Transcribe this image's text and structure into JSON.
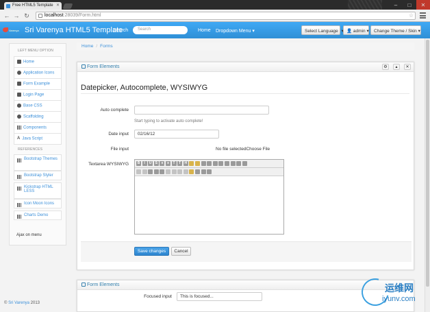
{
  "browser": {
    "tab_title": "Free HTML5 Template",
    "url_host": "localhost",
    "url_path": ":28039/Form.html"
  },
  "nav": {
    "logo_text": "Varenya",
    "brand": "Sri Varenya HTML5 Template",
    "search_label": "Search",
    "search_placeholder": "Search",
    "home": "Home",
    "dropdown": "Dropdown Menu",
    "language": "Select Language",
    "admin": "admin",
    "theme": "Change Theme / Skin"
  },
  "sidebar": {
    "main_heading": "LEFT MENU OPTION",
    "items": [
      {
        "label": "Home",
        "icon": "home-icon"
      },
      {
        "label": "Application Icons",
        "icon": "globe-icon"
      },
      {
        "label": "Form Example",
        "icon": "edit-icon"
      },
      {
        "label": "Login Page",
        "icon": "lock-icon"
      },
      {
        "label": "Base CSS",
        "icon": "eye-icon"
      },
      {
        "label": "Scaffolding",
        "icon": "globe-icon"
      },
      {
        "label": "Components",
        "icon": "grid-icon"
      },
      {
        "label": "Java Script",
        "icon": "font-icon"
      }
    ],
    "ref_heading": "REFERENCES",
    "refs": [
      {
        "label": "Bootstrap Themes"
      },
      {
        "label": "Bootstrap Styler"
      },
      {
        "label": "Kickstrap HTML LESS"
      },
      {
        "label": "Icon Moon Icons"
      },
      {
        "label": "Charts Demo"
      }
    ],
    "ajax": "Ajax on menu"
  },
  "footer": {
    "copy": "©",
    "link": "Sri Varenya",
    "year": "2013"
  },
  "breadcrumb": {
    "home": "Home",
    "sep": "/",
    "current": "Forms"
  },
  "box1": {
    "title": "Form Elements",
    "form_title": "Datepicker, Autocomplete, WYSIWYG",
    "autocomplete_label": "Auto complete",
    "autocomplete_help": "Start typing to activate auto complete!",
    "date_label": "Date input",
    "date_value": "02/16/12",
    "file_label": "File input",
    "file_text": "No file selectedChoose File",
    "textarea_label": "Textarea WYSIWYG",
    "save": "Save changes",
    "cancel": "Cancel"
  },
  "box2": {
    "title": "Form Elements",
    "focused_label": "Focused input",
    "focused_value": "This is focused..."
  },
  "watermark": {
    "cn": "运维网",
    "en": "iyunv.com"
  }
}
